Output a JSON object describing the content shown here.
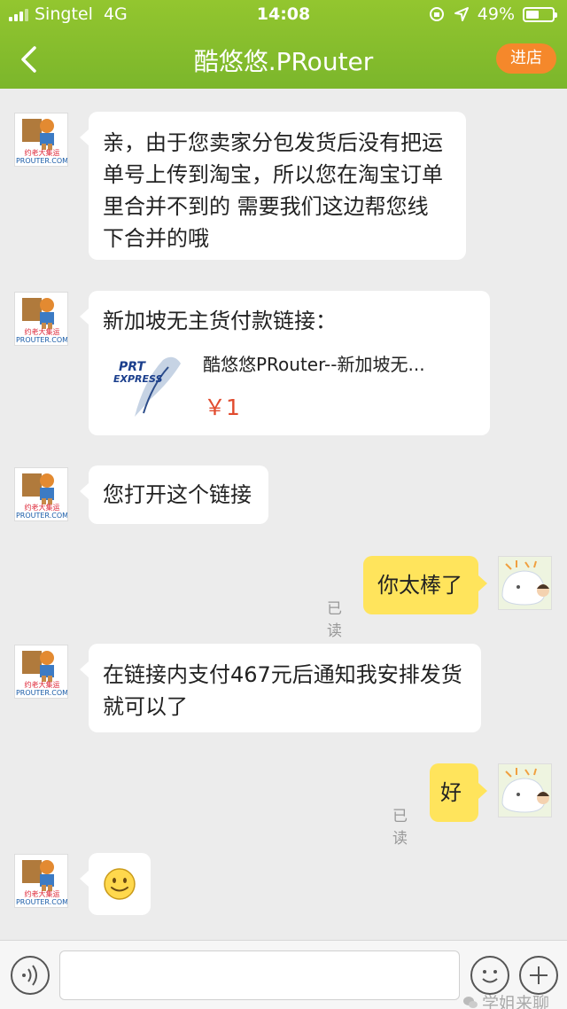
{
  "status_bar": {
    "carrier": "Singtel",
    "network": "4G",
    "time": "14:08",
    "battery": "49%"
  },
  "header": {
    "title": "酷悠悠.PRouter",
    "shop_button": "进店",
    "back_icon": "chevron-left-icon"
  },
  "avatars": {
    "merchant_label_top": "约老大集运",
    "merchant_label_bottom": "PROUTER.COM"
  },
  "messages": [
    {
      "side": "left",
      "lines": [
        "亲，由于您卖家分包发货后没有把运",
        "单号上传到淘宝，所以您在淘宝订单",
        "里合并不到的  需要我们这边帮您线",
        "下合并的哦"
      ]
    },
    {
      "side": "left",
      "type": "link-card",
      "text": "新加坡无主货付款链接：",
      "card_title": "酷悠悠PRouter--新加坡无...",
      "card_price": "￥1",
      "card_logo_top": "PRT",
      "card_logo_bottom": "EXPRESS"
    },
    {
      "side": "left",
      "lines": [
        "您打开这个链接"
      ]
    },
    {
      "side": "right",
      "lines": [
        "你太棒了"
      ],
      "status": "已读"
    },
    {
      "side": "left",
      "lines": [
        "在链接内支付467元后通知我安排发货",
        "就可以了"
      ]
    },
    {
      "side": "right",
      "lines": [
        "好"
      ],
      "status": "已读"
    },
    {
      "side": "left",
      "type": "emoji",
      "emoji": "smile-emoji"
    }
  ],
  "input_bar": {
    "voice_icon": "voice-icon",
    "emoji_icon": "emoji-icon",
    "add_icon": "plus-icon",
    "placeholder": ""
  },
  "watermark": "学姐来聊",
  "colors": {
    "header": "#7bb62b",
    "accent_button": "#f5882b",
    "own_bubble": "#ffe45c",
    "price": "#e14b2e"
  }
}
